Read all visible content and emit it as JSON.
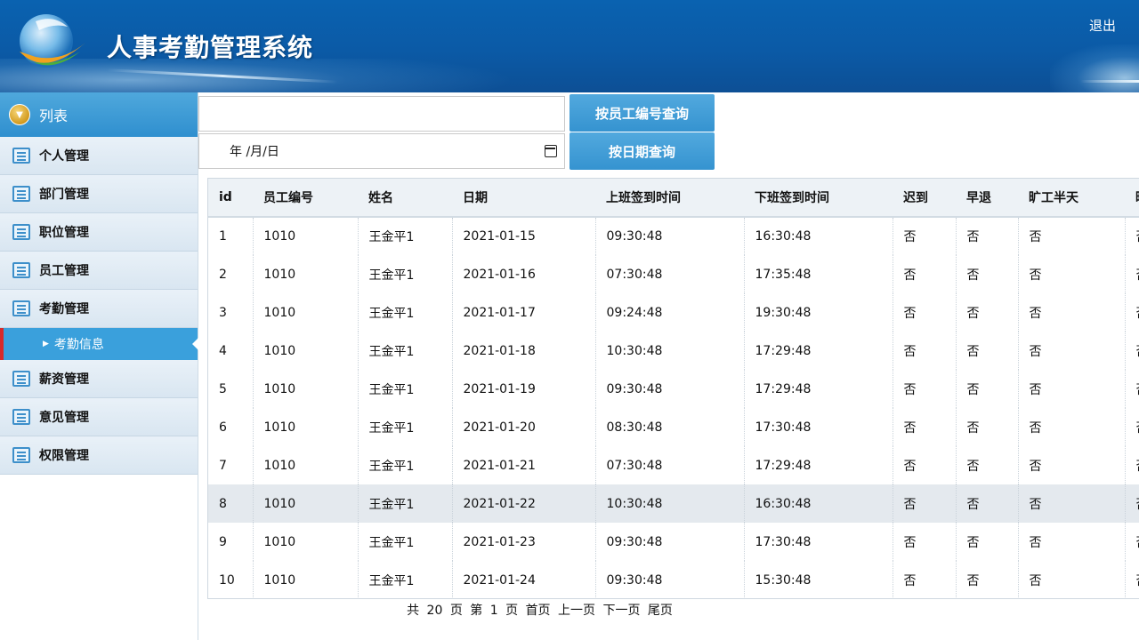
{
  "header": {
    "title": "人事考勤管理系统",
    "logout_label": "退出"
  },
  "sidebar": {
    "head_label": "列表",
    "items": [
      {
        "label": "个人管理"
      },
      {
        "label": "部门管理"
      },
      {
        "label": "职位管理"
      },
      {
        "label": "员工管理"
      },
      {
        "label": "考勤管理"
      }
    ],
    "sub_item": {
      "label": "考勤信息"
    },
    "items_after": [
      {
        "label": "薪资管理"
      },
      {
        "label": "意见管理"
      },
      {
        "label": "权限管理"
      }
    ]
  },
  "search": {
    "id_value": "",
    "date_value": "年  /月/日",
    "btn_by_id": "按员工编号查询",
    "btn_by_date": "按日期查询"
  },
  "table": {
    "columns": [
      "id",
      "员工编号",
      "姓名",
      "日期",
      "上班签到时间",
      "下班签到时间",
      "迟到",
      "早退",
      "旷工半天",
      "旷"
    ],
    "rows": [
      [
        "1",
        "1010",
        "王金平1",
        "2021-01-15",
        "09:30:48",
        "16:30:48",
        "否",
        "否",
        "否",
        "否"
      ],
      [
        "2",
        "1010",
        "王金平1",
        "2021-01-16",
        "07:30:48",
        "17:35:48",
        "否",
        "否",
        "否",
        "否"
      ],
      [
        "3",
        "1010",
        "王金平1",
        "2021-01-17",
        "09:24:48",
        "19:30:48",
        "否",
        "否",
        "否",
        "否"
      ],
      [
        "4",
        "1010",
        "王金平1",
        "2021-01-18",
        "10:30:48",
        "17:29:48",
        "否",
        "否",
        "否",
        "否"
      ],
      [
        "5",
        "1010",
        "王金平1",
        "2021-01-19",
        "09:30:48",
        "17:29:48",
        "否",
        "否",
        "否",
        "否"
      ],
      [
        "6",
        "1010",
        "王金平1",
        "2021-01-20",
        "08:30:48",
        "17:30:48",
        "否",
        "否",
        "否",
        "否"
      ],
      [
        "7",
        "1010",
        "王金平1",
        "2021-01-21",
        "07:30:48",
        "17:29:48",
        "否",
        "否",
        "否",
        "否"
      ],
      [
        "8",
        "1010",
        "王金平1",
        "2021-01-22",
        "10:30:48",
        "16:30:48",
        "否",
        "否",
        "否",
        "否"
      ],
      [
        "9",
        "1010",
        "王金平1",
        "2021-01-23",
        "09:30:48",
        "17:30:48",
        "否",
        "否",
        "否",
        "否"
      ],
      [
        "10",
        "1010",
        "王金平1",
        "2021-01-24",
        "09:30:48",
        "15:30:48",
        "否",
        "否",
        "否",
        "否"
      ]
    ],
    "highlighted_row_index": 7
  },
  "pager": {
    "total_prefix": "共",
    "total_pages": "20",
    "page_unit": "页",
    "current_prefix": "第",
    "current_page": "1",
    "first": "首页",
    "prev": "上一页",
    "next": "下一页",
    "last": "尾页"
  },
  "colors": {
    "header_bg": "#0b5aa6",
    "accent": "#3aa0dc",
    "active_marker": "#d62a2a"
  }
}
